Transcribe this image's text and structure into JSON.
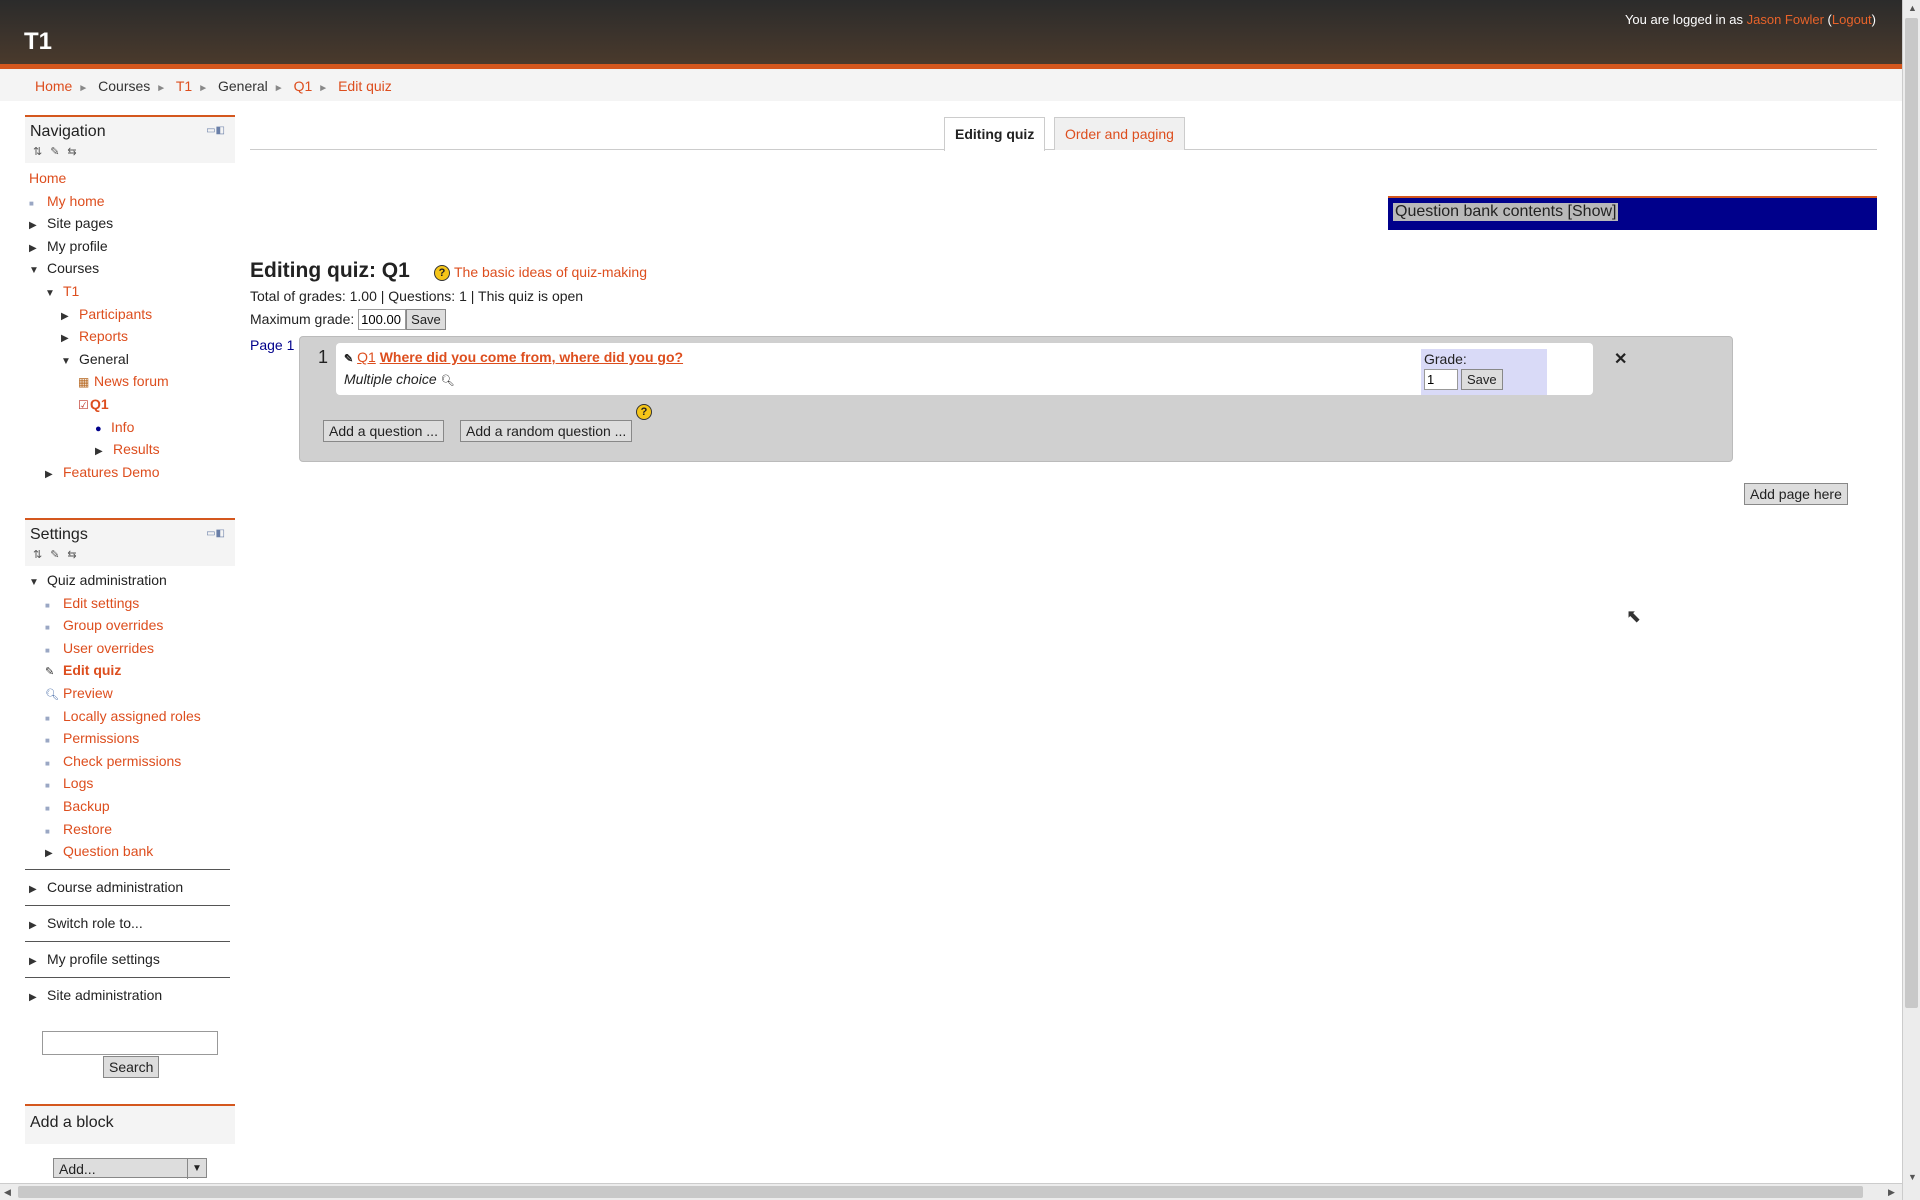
{
  "header": {
    "site_title": "T1",
    "login_prefix": "You are logged in as ",
    "user_name": "Jason Fowler",
    "logout": "Logout"
  },
  "breadcrumb": [
    "Home",
    "Courses",
    "T1",
    "General",
    "Q1",
    "Edit quiz"
  ],
  "navigation": {
    "title": "Navigation",
    "items": [
      {
        "label": "Home"
      },
      {
        "label": "My home"
      },
      {
        "label": "Site pages"
      },
      {
        "label": "My profile"
      },
      {
        "label": "Courses"
      },
      {
        "label": "T1"
      },
      {
        "label": "Participants"
      },
      {
        "label": "Reports"
      },
      {
        "label": "General"
      },
      {
        "label": "News forum"
      },
      {
        "label": "Q1"
      },
      {
        "label": "Info"
      },
      {
        "label": "Results"
      },
      {
        "label": "Features Demo"
      }
    ]
  },
  "settings": {
    "title": "Settings",
    "quiz_admin": "Quiz administration",
    "items": [
      "Edit settings",
      "Group overrides",
      "User overrides",
      "Edit quiz",
      "Preview",
      "Locally assigned roles",
      "Permissions",
      "Check permissions",
      "Logs",
      "Backup",
      "Restore",
      "Question bank"
    ],
    "extra": [
      "Course administration",
      "Switch role to...",
      "My profile settings",
      "Site administration"
    ]
  },
  "search": {
    "button": "Search",
    "value": ""
  },
  "add_block": {
    "title": "Add a block",
    "select_value": "Add..."
  },
  "tabs": [
    "Editing quiz",
    "Order and paging"
  ],
  "qbank": {
    "label": "Question bank contents [Show]"
  },
  "quiz": {
    "title": "Editing quiz: Q1",
    "help_link": "The basic ideas of quiz-making",
    "totals": "Total of grades: 1.00 | Questions: 1 | This quiz is open",
    "max_grade_label": "Maximum grade:",
    "max_grade_value": "100.00",
    "save": "Save",
    "page_label": "Page 1",
    "question": {
      "number": "1",
      "id": "Q1",
      "title": "Where did you come from, where did you go?",
      "type": "Multiple choice",
      "grade_label": "Grade:",
      "grade_value": "1",
      "save": "Save"
    },
    "add_question": "Add a question ...",
    "add_random": "Add a random question ...",
    "add_page": "Add page here"
  }
}
